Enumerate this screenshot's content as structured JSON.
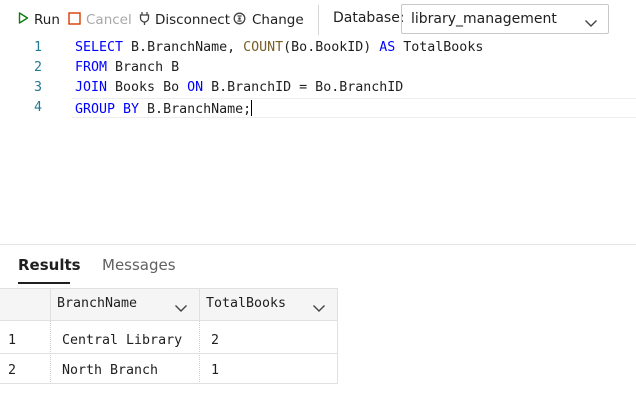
{
  "toolbar": {
    "run_label": "Run",
    "cancel_label": "Cancel",
    "disconnect_label": "Disconnect",
    "change_label": "Change",
    "database_label": "Database:",
    "database_value": "library_management"
  },
  "colors": {
    "run_icon": "#107c10",
    "cancel_icon": "#d83b01",
    "keyword": "#0000ff",
    "function": "#795e26",
    "line_number": "#237893"
  },
  "editor": {
    "lines": [
      {
        "num": "1",
        "tokens": [
          [
            "kw",
            "SELECT"
          ],
          [
            "",
            " B.BranchName, "
          ],
          [
            "fn",
            "COUNT"
          ],
          [
            "",
            "(Bo.BookID) "
          ],
          [
            "kw",
            "AS"
          ],
          [
            "",
            " TotalBooks"
          ]
        ]
      },
      {
        "num": "2",
        "tokens": [
          [
            "kw",
            "FROM"
          ],
          [
            "",
            " Branch B"
          ]
        ]
      },
      {
        "num": "3",
        "tokens": [
          [
            "kw",
            "JOIN"
          ],
          [
            "",
            " Books Bo "
          ],
          [
            "kw",
            "ON"
          ],
          [
            "",
            " B.BranchID = Bo.BranchID"
          ]
        ]
      },
      {
        "num": "4",
        "tokens": [
          [
            "kw",
            "GROUP BY"
          ],
          [
            "",
            " B.BranchName;"
          ]
        ]
      }
    ]
  },
  "results": {
    "tabs": [
      "Results",
      "Messages"
    ],
    "columns": [
      "BranchName",
      "TotalBooks"
    ],
    "rows": [
      {
        "index": "1",
        "cells": [
          "Central Library",
          "2"
        ]
      },
      {
        "index": "2",
        "cells": [
          "North Branch",
          "1"
        ]
      }
    ]
  }
}
